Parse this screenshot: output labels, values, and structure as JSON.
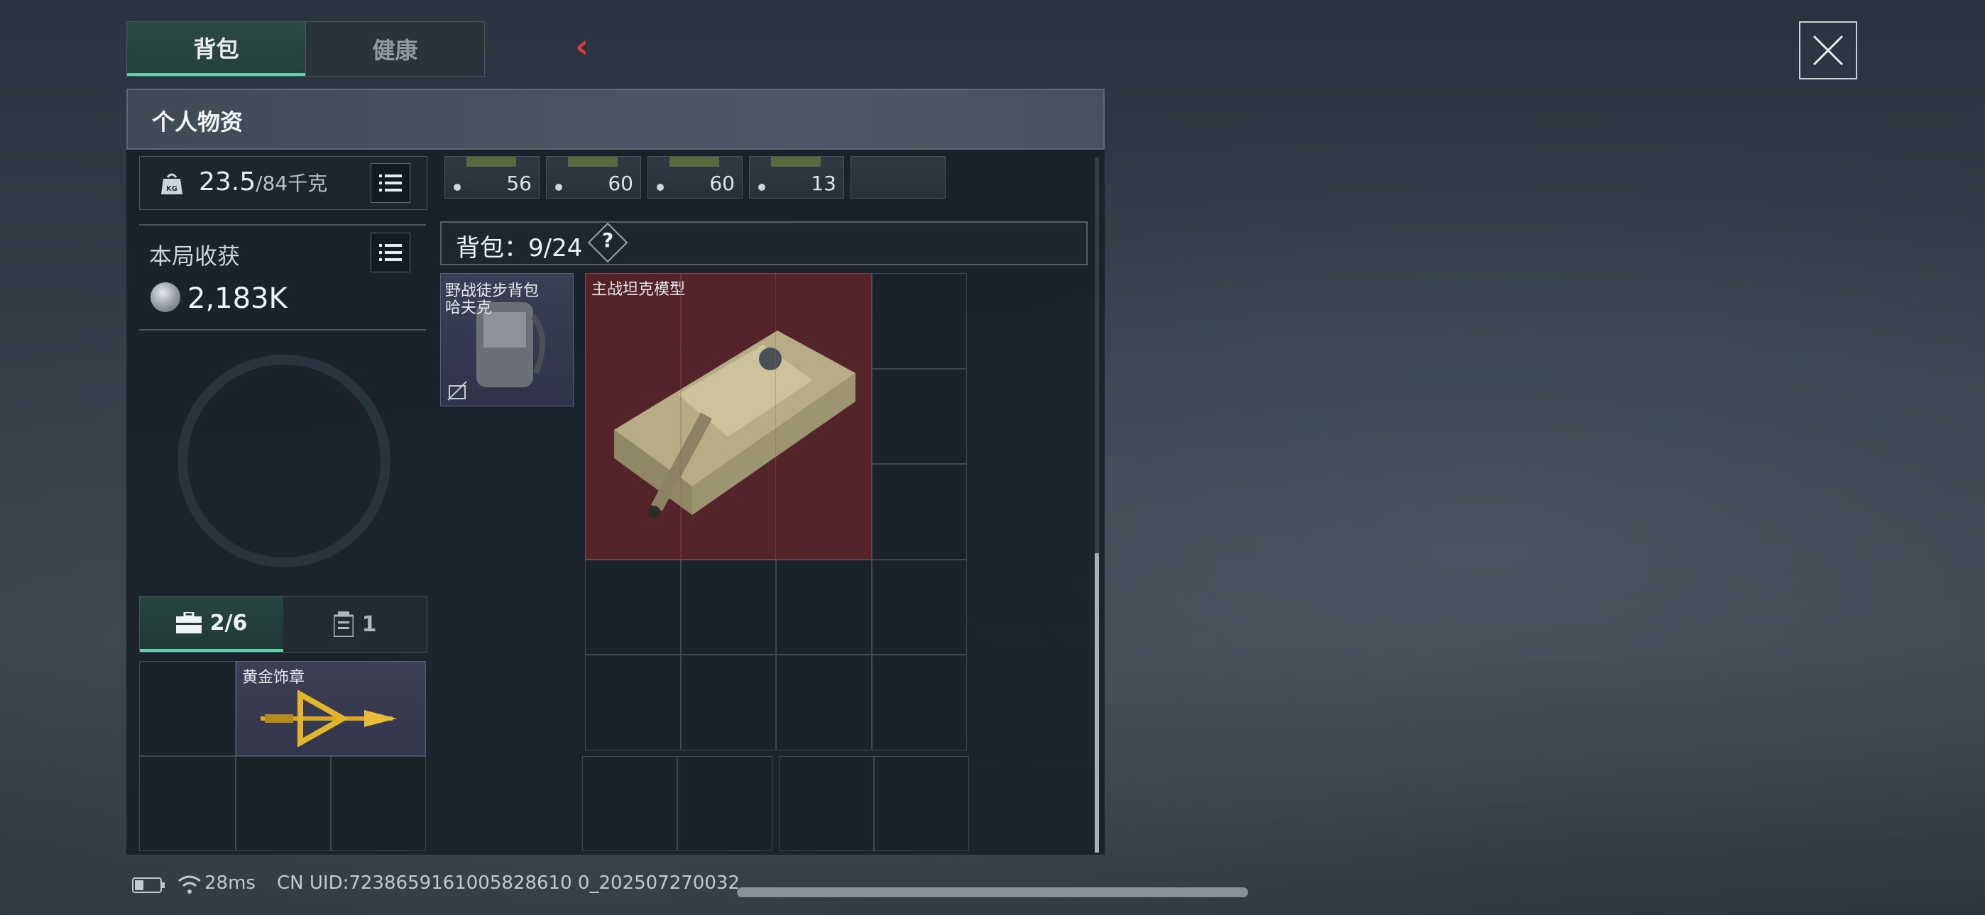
{
  "tabs": [
    "背包",
    "健康"
  ],
  "panel": {
    "title": "个人物资"
  },
  "weight": {
    "current": "23.5",
    "max": "/84千克"
  },
  "earnings": {
    "label": "本局收获",
    "value": "2,183K"
  },
  "secure": {
    "tab1": "2/6",
    "tab2": "1",
    "item_name": "黄金饰章"
  },
  "ammo": [
    "56",
    "60",
    "60",
    "13"
  ],
  "backpack": {
    "label": "背包：9/24",
    "help": "?",
    "item_line1": "野战徒步背包",
    "item_line2": "哈夫克"
  },
  "tank": {
    "name": "主战坦克模型"
  },
  "status": {
    "ping": "28ms",
    "uid": "CN UID:7238659161005828610 0_202507270032"
  },
  "colors": {
    "accent": "#5fd0a8",
    "back": "#e03a3a",
    "tank_bg": "#6e242a"
  }
}
